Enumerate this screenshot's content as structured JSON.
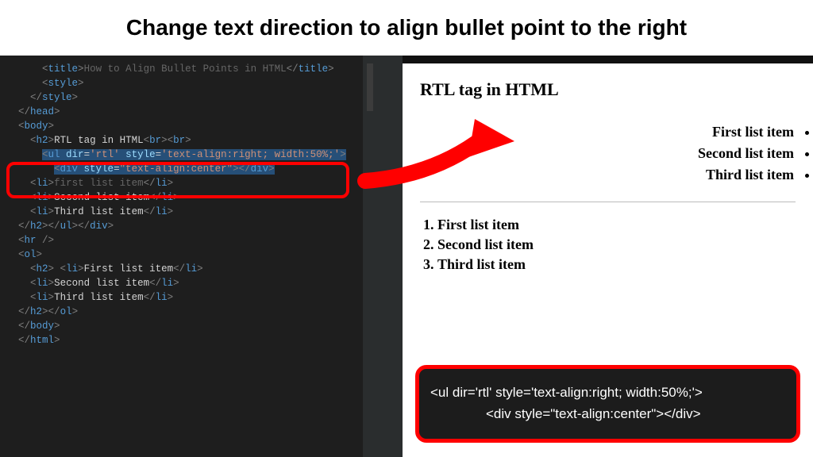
{
  "title": "Change text direction to align bullet point to the right",
  "editor": {
    "lines": [
      {
        "indent": 3,
        "frags": [
          {
            "t": "bracket",
            "v": "<"
          },
          {
            "t": "tag",
            "v": "title"
          },
          {
            "t": "bracket",
            "v": ">"
          },
          {
            "t": "dim",
            "v": "How to Align Bullet Points in HTML"
          },
          {
            "t": "bracket",
            "v": "</"
          },
          {
            "t": "tag",
            "v": "title"
          },
          {
            "t": "bracket",
            "v": ">"
          }
        ]
      },
      {
        "indent": 3,
        "frags": [
          {
            "t": "bracket",
            "v": "<"
          },
          {
            "t": "tag",
            "v": "style"
          },
          {
            "t": "bracket",
            "v": ">"
          }
        ]
      },
      {
        "indent": 2,
        "frags": [
          {
            "t": "bracket",
            "v": "</"
          },
          {
            "t": "tag",
            "v": "style"
          },
          {
            "t": "bracket",
            "v": ">"
          }
        ]
      },
      {
        "indent": 0,
        "frags": []
      },
      {
        "indent": 1,
        "frags": [
          {
            "t": "bracket",
            "v": "</"
          },
          {
            "t": "tag",
            "v": "head"
          },
          {
            "t": "bracket",
            "v": ">"
          }
        ]
      },
      {
        "indent": 1,
        "frags": [
          {
            "t": "bracket",
            "v": "<"
          },
          {
            "t": "tag",
            "v": "body"
          },
          {
            "t": "bracket",
            "v": ">"
          }
        ]
      },
      {
        "indent": 0,
        "frags": []
      },
      {
        "indent": 2,
        "frags": [
          {
            "t": "bracket",
            "v": "<"
          },
          {
            "t": "tag",
            "v": "h2"
          },
          {
            "t": "bracket",
            "v": ">"
          },
          {
            "t": "text",
            "v": "RTL tag in HTML"
          },
          {
            "t": "bracket",
            "v": "<"
          },
          {
            "t": "tag",
            "v": "br"
          },
          {
            "t": "bracket",
            "v": "><"
          },
          {
            "t": "tag",
            "v": "br"
          },
          {
            "t": "bracket",
            "v": ">"
          }
        ]
      },
      {
        "indent": 0,
        "frags": []
      },
      {
        "indent": 3,
        "sel": true,
        "frags": [
          {
            "t": "bracket",
            "v": "<"
          },
          {
            "t": "tag",
            "v": "ul "
          },
          {
            "t": "attr",
            "v": "dir"
          },
          {
            "t": "text",
            "v": "="
          },
          {
            "t": "str",
            "v": "'rtl'"
          },
          {
            "t": "text",
            "v": " "
          },
          {
            "t": "attr",
            "v": "style"
          },
          {
            "t": "text",
            "v": "="
          },
          {
            "t": "str",
            "v": "'text-align:right; width:50%;'"
          },
          {
            "t": "bracket",
            "v": ">"
          }
        ]
      },
      {
        "indent": 4,
        "sel": true,
        "frags": [
          {
            "t": "bracket",
            "v": "<"
          },
          {
            "t": "tag",
            "v": "div "
          },
          {
            "t": "attr",
            "v": "style"
          },
          {
            "t": "text",
            "v": "="
          },
          {
            "t": "str",
            "v": "\"text-align:center\""
          },
          {
            "t": "bracket",
            "v": "></"
          },
          {
            "t": "tag",
            "v": "div"
          },
          {
            "t": "bracket",
            "v": ">"
          }
        ]
      },
      {
        "indent": 2,
        "frags": [
          {
            "t": "bracket",
            "v": "<"
          },
          {
            "t": "tag",
            "v": "li"
          },
          {
            "t": "bracket",
            "v": ">"
          },
          {
            "t": "dim",
            "v": "first list item"
          },
          {
            "t": "bracket",
            "v": "</"
          },
          {
            "t": "tag",
            "v": "li"
          },
          {
            "t": "bracket",
            "v": ">"
          }
        ]
      },
      {
        "indent": 2,
        "frags": [
          {
            "t": "bracket",
            "v": "<"
          },
          {
            "t": "tag",
            "v": "li"
          },
          {
            "t": "bracket",
            "v": ">"
          },
          {
            "t": "text",
            "v": "Second list item"
          },
          {
            "t": "bracket",
            "v": "</"
          },
          {
            "t": "tag",
            "v": "li"
          },
          {
            "t": "bracket",
            "v": ">"
          }
        ]
      },
      {
        "indent": 2,
        "frags": [
          {
            "t": "bracket",
            "v": "<"
          },
          {
            "t": "tag",
            "v": "li"
          },
          {
            "t": "bracket",
            "v": ">"
          },
          {
            "t": "text",
            "v": "Third list item"
          },
          {
            "t": "bracket",
            "v": "</"
          },
          {
            "t": "tag",
            "v": "li"
          },
          {
            "t": "bracket",
            "v": ">"
          }
        ]
      },
      {
        "indent": 1,
        "frags": [
          {
            "t": "bracket",
            "v": "</"
          },
          {
            "t": "tag",
            "v": "h2"
          },
          {
            "t": "bracket",
            "v": "></"
          },
          {
            "t": "tag",
            "v": "ul"
          },
          {
            "t": "bracket",
            "v": "></"
          },
          {
            "t": "tag",
            "v": "div"
          },
          {
            "t": "bracket",
            "v": ">"
          }
        ]
      },
      {
        "indent": 0,
        "frags": []
      },
      {
        "indent": 1,
        "frags": [
          {
            "t": "bracket",
            "v": "<"
          },
          {
            "t": "tag",
            "v": "hr "
          },
          {
            "t": "bracket",
            "v": "/>"
          }
        ]
      },
      {
        "indent": 0,
        "frags": []
      },
      {
        "indent": 1,
        "frags": [
          {
            "t": "bracket",
            "v": "<"
          },
          {
            "t": "tag",
            "v": "ol"
          },
          {
            "t": "bracket",
            "v": ">"
          }
        ]
      },
      {
        "indent": 2,
        "frags": [
          {
            "t": "bracket",
            "v": "<"
          },
          {
            "t": "tag",
            "v": "h2"
          },
          {
            "t": "bracket",
            "v": "> <"
          },
          {
            "t": "tag",
            "v": "li"
          },
          {
            "t": "bracket",
            "v": ">"
          },
          {
            "t": "text",
            "v": "First list item"
          },
          {
            "t": "bracket",
            "v": "</"
          },
          {
            "t": "tag",
            "v": "li"
          },
          {
            "t": "bracket",
            "v": ">"
          }
        ]
      },
      {
        "indent": 2,
        "frags": [
          {
            "t": "bracket",
            "v": "<"
          },
          {
            "t": "tag",
            "v": "li"
          },
          {
            "t": "bracket",
            "v": ">"
          },
          {
            "t": "text",
            "v": "Second list item"
          },
          {
            "t": "bracket",
            "v": "</"
          },
          {
            "t": "tag",
            "v": "li"
          },
          {
            "t": "bracket",
            "v": ">"
          }
        ]
      },
      {
        "indent": 2,
        "frags": [
          {
            "t": "bracket",
            "v": "<"
          },
          {
            "t": "tag",
            "v": "li"
          },
          {
            "t": "bracket",
            "v": ">"
          },
          {
            "t": "text",
            "v": "Third list item"
          },
          {
            "t": "bracket",
            "v": "</"
          },
          {
            "t": "tag",
            "v": "li"
          },
          {
            "t": "bracket",
            "v": ">"
          }
        ]
      },
      {
        "indent": 1,
        "frags": [
          {
            "t": "bracket",
            "v": "</"
          },
          {
            "t": "tag",
            "v": "h2"
          },
          {
            "t": "bracket",
            "v": "></"
          },
          {
            "t": "tag",
            "v": "ol"
          },
          {
            "t": "bracket",
            "v": ">"
          }
        ]
      },
      {
        "indent": 0,
        "frags": []
      },
      {
        "indent": 1,
        "frags": [
          {
            "t": "bracket",
            "v": "</"
          },
          {
            "t": "tag",
            "v": "body"
          },
          {
            "t": "bracket",
            "v": ">"
          }
        ]
      },
      {
        "indent": 1,
        "frags": [
          {
            "t": "bracket",
            "v": "</"
          },
          {
            "t": "tag",
            "v": "html"
          },
          {
            "t": "bracket",
            "v": ">"
          }
        ]
      }
    ]
  },
  "output": {
    "heading": "RTL tag in HTML",
    "rtl_items": [
      "First list item",
      "Second list item",
      "Third list item"
    ],
    "ol_items": [
      "First list item",
      "Second list item",
      "Third list item"
    ],
    "snippet_line1": "<ul dir='rtl' style='text-align:right; width:50%;'>",
    "snippet_line2": "<div style=\"text-align:center\"></div>"
  }
}
